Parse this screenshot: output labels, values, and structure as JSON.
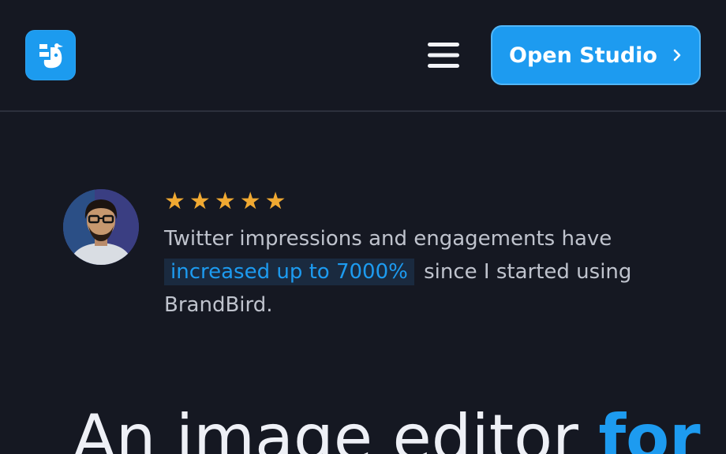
{
  "header": {
    "logo_name": "BrandBird",
    "menu_icon": "hamburger-menu-icon",
    "cta_label": "Open Studio",
    "cta_icon": "chevron-right-icon"
  },
  "testimonial": {
    "rating": 5,
    "rating_max": 5,
    "quote_before": "Twitter impressions and engagements have",
    "quote_highlight": "increased up to 7000%",
    "quote_after": "since I started using BrandBird."
  },
  "hero": {
    "headline_main": "An image editor",
    "headline_accent": "for"
  },
  "colors": {
    "background": "#151822",
    "accent": "#1d9bf0",
    "star": "#f0a932",
    "text_muted": "#bfc3cd",
    "text_strong": "#eef0f6"
  }
}
